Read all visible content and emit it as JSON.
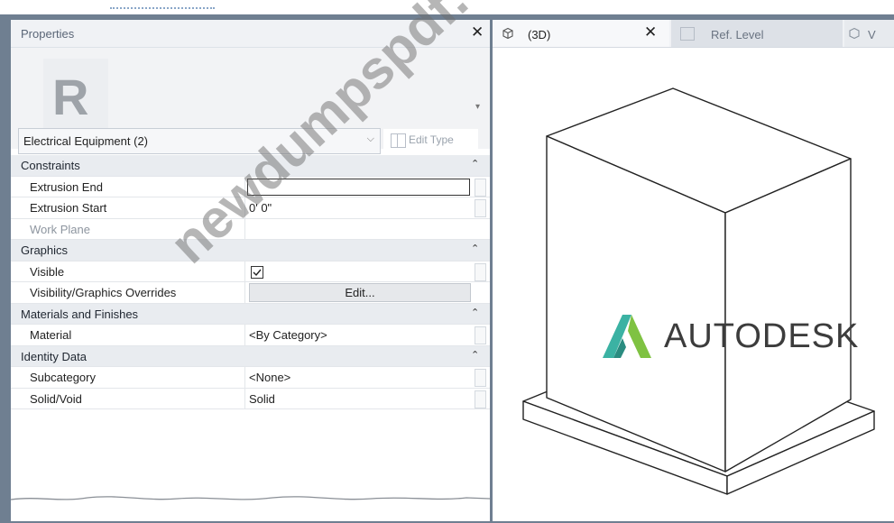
{
  "properties_panel": {
    "title": "Properties",
    "close_glyph": "✕",
    "logo_letter": "R",
    "type_selector": {
      "value": "Electrical Equipment (2)",
      "edit_type_label": "Edit Type"
    },
    "groups": [
      {
        "name": "Constraints",
        "rows": [
          {
            "name": "Extrusion End",
            "value": ""
          },
          {
            "name": "Extrusion Start",
            "value": "0'  0\""
          },
          {
            "name": "Work Plane",
            "value": ""
          }
        ]
      },
      {
        "name": "Graphics",
        "rows": [
          {
            "name": "Visible",
            "value": "checked"
          },
          {
            "name": "Visibility/Graphics Overrides",
            "value": "Edit..."
          }
        ]
      },
      {
        "name": "Materials and Finishes",
        "rows": [
          {
            "name": "Material",
            "value": "<By Category>"
          }
        ]
      },
      {
        "name": "Identity Data",
        "rows": [
          {
            "name": "Subcategory",
            "value": "<None>"
          },
          {
            "name": "Solid/Void",
            "value": "Solid"
          }
        ]
      }
    ]
  },
  "view_tabs": [
    {
      "label": "(3D)",
      "icon": "3d-view-icon",
      "active": true
    },
    {
      "label": "Ref. Level",
      "icon": "plan-view-icon",
      "active": false
    },
    {
      "label": "V",
      "icon": "view-icon",
      "active": false
    }
  ],
  "branding": {
    "autodesk_wordmark": "AUTODESK",
    "accent_teal": "#3bb2a3",
    "accent_green": "#7fc242"
  },
  "watermark": "newdumpspdf.com"
}
